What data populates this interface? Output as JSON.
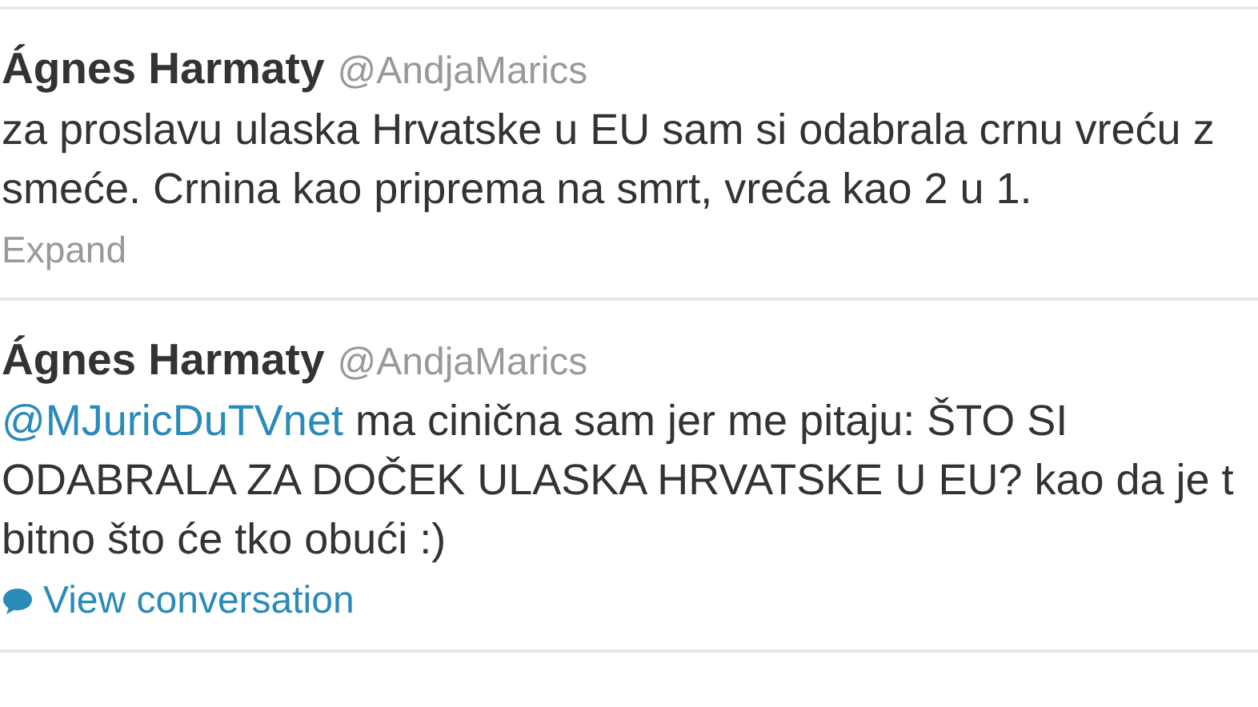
{
  "tweets": [
    {
      "name": "Ágnes Harmaty",
      "handle": "@AndjaMarics",
      "lines": [
        "za proslavu ulaska Hrvatske u EU sam si odabrala crnu vreću z",
        "smeće. Crnina kao priprema na smrt, vreća kao 2 u 1."
      ],
      "action": {
        "kind": "expand",
        "label": "Expand"
      }
    },
    {
      "name": "Ágnes Harmaty",
      "handle": "@AndjaMarics",
      "mention": "@MJuricDuTVnet",
      "lines": [
        " ma cinična sam jer me pitaju: ŠTO SI",
        "ODABRALA ZA DOČEK ULASKA HRVATSKE U EU? kao da je t",
        "bitno što će tko obući :)"
      ],
      "action": {
        "kind": "conversation",
        "label": "View conversation"
      }
    }
  ]
}
